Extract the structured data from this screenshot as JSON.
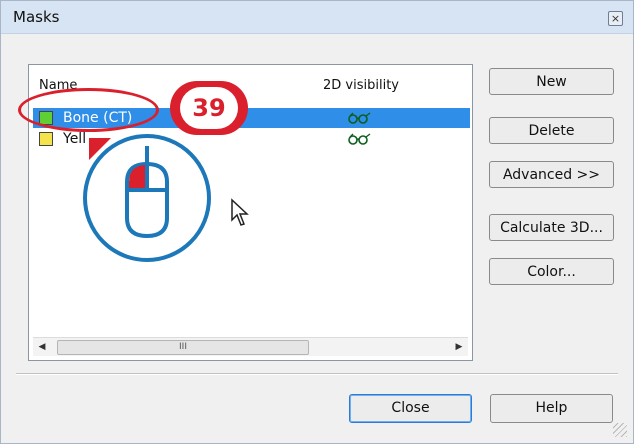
{
  "window": {
    "title": "Masks",
    "close_glyph": "×"
  },
  "list": {
    "columns": [
      "Name",
      "2D visibility"
    ],
    "rows": [
      {
        "name": "Bone (CT)",
        "selected": true,
        "cube_color": "#5fcf35",
        "visibility_icon": "glasses-icon"
      },
      {
        "name": "Yellow",
        "visible_text": "Yell",
        "selected": false,
        "cube_color": "#f4e34a",
        "visibility_icon": "glasses-icon"
      }
    ],
    "scrollbar_thumb_grip": "III"
  },
  "buttons": {
    "new": "New",
    "delete": "Delete",
    "advanced": "Advanced >>",
    "calculate_3d": "Calculate 3D...",
    "color": "Color...",
    "close": "Close",
    "help": "Help"
  },
  "annotation": {
    "step_number": "39",
    "accent_color": "#d9202c",
    "mouse_color": "#1d78b9"
  }
}
